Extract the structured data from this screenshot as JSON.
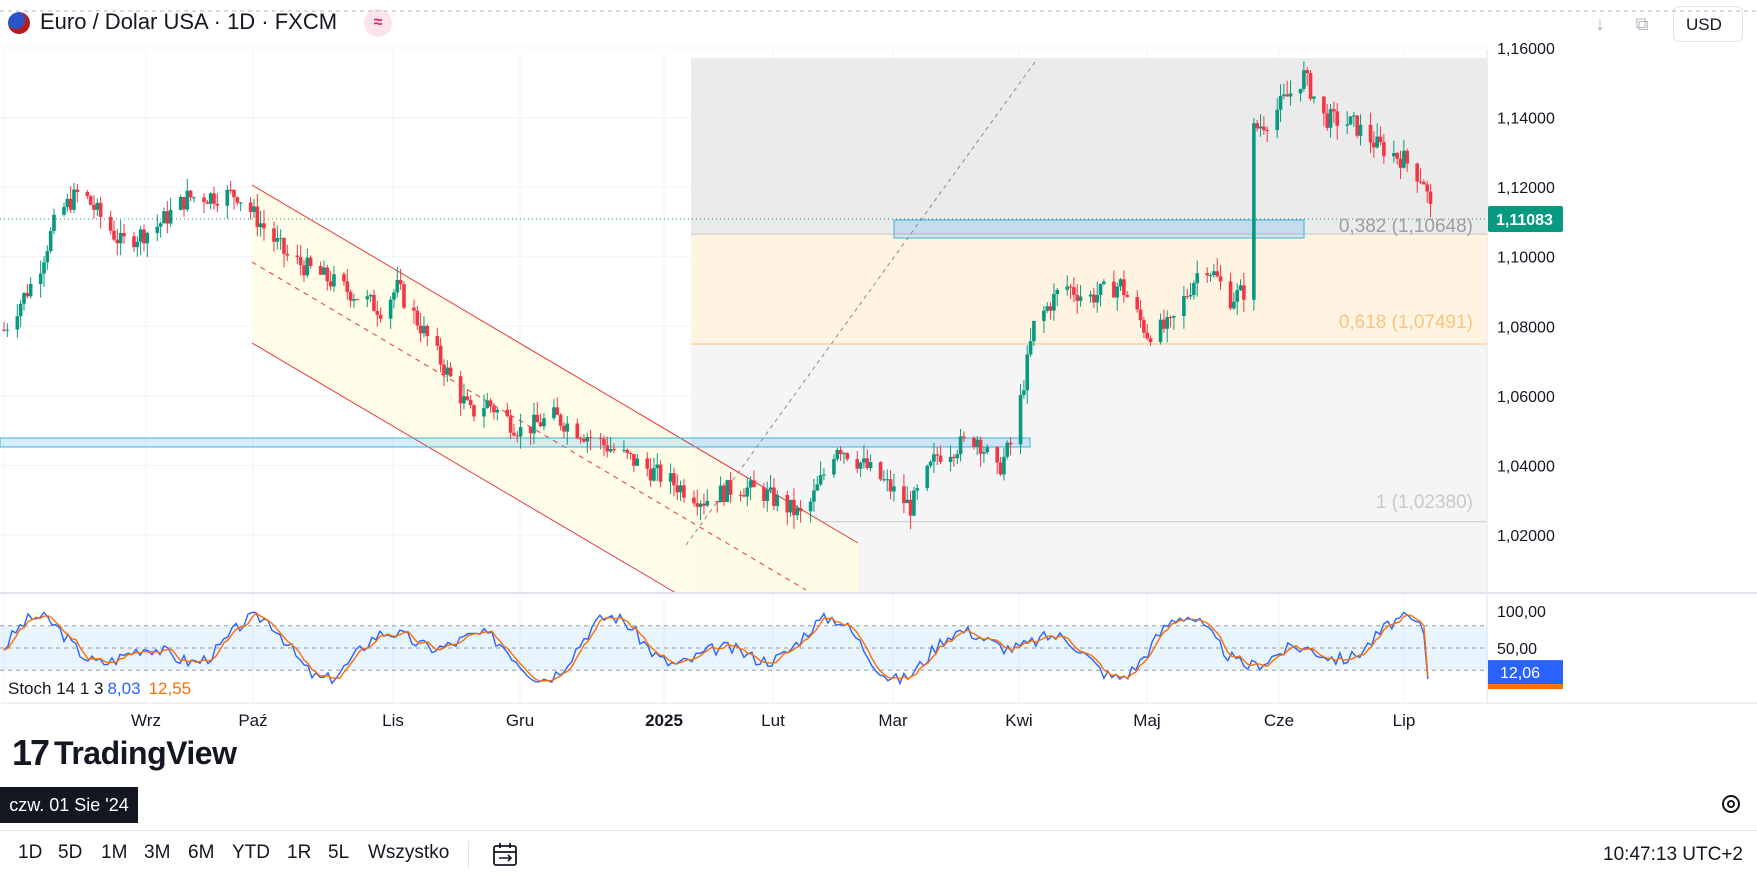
{
  "header": {
    "title": "Euro / Dolar USA · 1D · FXCM",
    "currency": "USD",
    "icons": [
      "flag-icon",
      "live-data-icon",
      "download-icon",
      "restore-icon"
    ]
  },
  "fib_labels": {
    "l0382": "0,382 (1,10648)",
    "l0618": "0,618 (1,07491)",
    "l1": "1 (1,02380)"
  },
  "price_axis": {
    "ticks": [
      "1,16000",
      "1,14000",
      "1,12000",
      "1,10000",
      "1,08000",
      "1,06000",
      "1,04000",
      "1,02000"
    ],
    "current_price": "1,11083",
    "current_price_color": "#089981"
  },
  "stoch_axis": {
    "ticks": [
      "100,00",
      "50,00"
    ],
    "current_value": "12,06"
  },
  "stoch_legend": {
    "name": "Stoch 14 1 3",
    "k": "8,03",
    "d": "12,55"
  },
  "time_axis": {
    "labels": [
      "Wrz",
      "Paź",
      "Lis",
      "Gru",
      "2025",
      "Lut",
      "Mar",
      "Kwi",
      "Maj",
      "Cze",
      "Lip"
    ]
  },
  "date_tooltip": "czw. 01 Sie '24",
  "logo": "TradingView",
  "bottom_bar": {
    "ranges": [
      "1D",
      "5D",
      "1M",
      "3M",
      "6M",
      "YTD",
      "1R",
      "5L",
      "Wszystko"
    ],
    "clock": "10:47:13 UTC+2"
  },
  "colors": {
    "up": "#089981",
    "down": "#f23645",
    "stoch_k": "#2962ff",
    "stoch_d": "#ff6d00",
    "fib_orange": "#f8c47e",
    "channel": "#e53935"
  },
  "chart_data": {
    "type": "candlestick",
    "symbol": "EURUSD",
    "interval": "1D",
    "ylim": [
      1.0,
      1.165
    ],
    "x_range": [
      "2024-08-01",
      "2025-07-31"
    ],
    "ohlc_samples": [
      {
        "date": "2024-08-01",
        "o": 1.079,
        "h": 1.086,
        "l": 1.077,
        "c": 1.083
      },
      {
        "date": "2024-08-23",
        "o": 1.112,
        "h": 1.12,
        "l": 1.11,
        "c": 1.119
      },
      {
        "date": "2024-09-25",
        "o": 1.116,
        "h": 1.121,
        "l": 1.113,
        "c": 1.118
      },
      {
        "date": "2024-10-31",
        "o": 1.085,
        "h": 1.093,
        "l": 1.082,
        "c": 1.088
      },
      {
        "date": "2024-11-22",
        "o": 1.047,
        "h": 1.05,
        "l": 1.033,
        "c": 1.046
      },
      {
        "date": "2025-01-13",
        "o": 1.025,
        "h": 1.027,
        "l": 1.018,
        "c": 1.025
      },
      {
        "date": "2025-02-28",
        "o": 1.04,
        "h": 1.04,
        "l": 1.035,
        "c": 1.038
      },
      {
        "date": "2025-03-04",
        "o": 1.048,
        "h": 1.062,
        "l": 1.047,
        "c": 1.062
      },
      {
        "date": "2025-04-07",
        "o": 1.096,
        "h": 1.099,
        "l": 1.088,
        "c": 1.091
      },
      {
        "date": "2025-04-11",
        "o": 1.103,
        "h": 1.136,
        "l": 1.102,
        "c": 1.135
      },
      {
        "date": "2025-04-21",
        "o": 1.151,
        "h": 1.157,
        "l": 1.147,
        "c": 1.15
      },
      {
        "date": "2025-05-12",
        "o": 1.108,
        "h": 1.11,
        "l": 1.106,
        "c": 1.109
      }
    ],
    "fib_retracement": [
      {
        "level": "0,382",
        "price": 1.10648
      },
      {
        "level": "0,618",
        "price": 1.07491
      },
      {
        "level": "1",
        "price": 1.0238
      }
    ],
    "zones": [
      {
        "name": "support-zone",
        "from": 1.0457,
        "to": 1.0475,
        "start": "2024-08-01",
        "end": "2025-04-03"
      },
      {
        "name": "resistance-zone",
        "from": 1.1055,
        "to": 1.11,
        "start": "2025-03-03",
        "end": "2025-05-26"
      }
    ],
    "channel": {
      "start": "2024-09-30",
      "end": "2025-02-19",
      "upper": [
        1.121,
        1.015
      ],
      "lower": [
        1.09,
        1.003
      ],
      "mid": [
        1.105,
        1.003
      ]
    },
    "stochastic": {
      "k": 8.03,
      "d": 12.55,
      "levels": [
        80,
        50,
        20
      ],
      "ylim": [
        0,
        100
      ]
    }
  }
}
